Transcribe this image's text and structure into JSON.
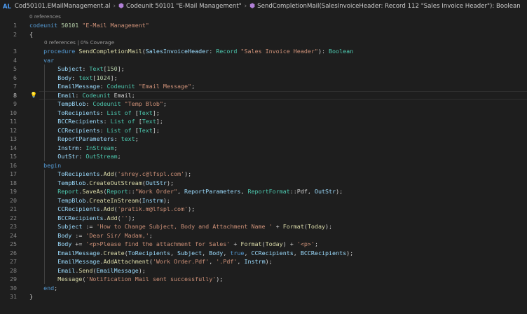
{
  "breadcrumb": {
    "lang_badge": "AL",
    "file": "Cod50101.EMailManagement.al",
    "codeunit": "Codeunit 50101 \"E-Mail Management\"",
    "procedure": "SendCompletionMail(SalesInvoiceHeader: Record 112 \"Sales Invoice Header\"): Boolean"
  },
  "hints": {
    "top_references": "0 references",
    "proc_references": "0 references | 0% Coverage"
  },
  "line_numbers": [
    "1",
    "2",
    "3",
    "4",
    "5",
    "6",
    "7",
    "8",
    "9",
    "10",
    "11",
    "12",
    "13",
    "14",
    "15",
    "16",
    "17",
    "18",
    "19",
    "20",
    "21",
    "22",
    "23",
    "24",
    "25",
    "26",
    "27",
    "28",
    "29",
    "30",
    "31"
  ],
  "code": [
    [
      [
        "k",
        "codeunit "
      ],
      [
        "n",
        "50101 "
      ],
      [
        "s",
        "\"E-Mail Management\""
      ]
    ],
    [
      [
        "p",
        "{"
      ]
    ],
    [
      [
        "p",
        "    "
      ],
      [
        "k",
        "procedure "
      ],
      [
        "f",
        "SendCompletionMail"
      ],
      [
        "p",
        "("
      ],
      [
        "v",
        "SalesInvoiceHeader"
      ],
      [
        "p",
        ": "
      ],
      [
        "t",
        "Record "
      ],
      [
        "s",
        "\"Sales Invoice Header\""
      ],
      [
        "p",
        "): "
      ],
      [
        "t",
        "Boolean"
      ]
    ],
    [
      [
        "p",
        "    "
      ],
      [
        "k",
        "var"
      ]
    ],
    [
      [
        "p",
        "        "
      ],
      [
        "v",
        "Subject"
      ],
      [
        "p",
        ": "
      ],
      [
        "t",
        "Text"
      ],
      [
        "p",
        "["
      ],
      [
        "n",
        "150"
      ],
      [
        "p",
        "];"
      ]
    ],
    [
      [
        "p",
        "        "
      ],
      [
        "v",
        "Body"
      ],
      [
        "p",
        ": "
      ],
      [
        "t",
        "text"
      ],
      [
        "p",
        "["
      ],
      [
        "n",
        "1024"
      ],
      [
        "p",
        "];"
      ]
    ],
    [
      [
        "p",
        "        "
      ],
      [
        "v",
        "EmailMessage"
      ],
      [
        "p",
        ": "
      ],
      [
        "t",
        "Codeunit "
      ],
      [
        "s",
        "\"Email Message\""
      ],
      [
        "p",
        ";"
      ]
    ],
    [
      [
        "p",
        "        "
      ],
      [
        "v",
        "Email"
      ],
      [
        "p",
        ": "
      ],
      [
        "t",
        "Codeunit "
      ],
      [
        "p",
        "Email;"
      ]
    ],
    [
      [
        "p",
        "        "
      ],
      [
        "v",
        "TempBlob"
      ],
      [
        "p",
        ": "
      ],
      [
        "t",
        "Codeunit "
      ],
      [
        "s",
        "\"Temp Blob\""
      ],
      [
        "p",
        ";"
      ]
    ],
    [
      [
        "p",
        "        "
      ],
      [
        "v",
        "ToRecipients"
      ],
      [
        "p",
        ": "
      ],
      [
        "t",
        "List of "
      ],
      [
        "p",
        "["
      ],
      [
        "t",
        "Text"
      ],
      [
        "p",
        "];"
      ]
    ],
    [
      [
        "p",
        "        "
      ],
      [
        "v",
        "BCCRecipients"
      ],
      [
        "p",
        ": "
      ],
      [
        "t",
        "List of "
      ],
      [
        "p",
        "["
      ],
      [
        "t",
        "Text"
      ],
      [
        "p",
        "];"
      ]
    ],
    [
      [
        "p",
        "        "
      ],
      [
        "v",
        "CCRecipients"
      ],
      [
        "p",
        ": "
      ],
      [
        "t",
        "List of "
      ],
      [
        "p",
        "["
      ],
      [
        "t",
        "Text"
      ],
      [
        "p",
        "];"
      ]
    ],
    [
      [
        "p",
        "        "
      ],
      [
        "v",
        "ReportParameters"
      ],
      [
        "p",
        ": "
      ],
      [
        "t",
        "text"
      ],
      [
        "p",
        ";"
      ]
    ],
    [
      [
        "p",
        "        "
      ],
      [
        "v",
        "Instrm"
      ],
      [
        "p",
        ": "
      ],
      [
        "t",
        "InStream"
      ],
      [
        "p",
        ";"
      ]
    ],
    [
      [
        "p",
        "        "
      ],
      [
        "v",
        "OutStr"
      ],
      [
        "p",
        ": "
      ],
      [
        "t",
        "OutStream"
      ],
      [
        "p",
        ";"
      ]
    ],
    [
      [
        "p",
        "    "
      ],
      [
        "k",
        "begin"
      ]
    ],
    [
      [
        "p",
        "        "
      ],
      [
        "v",
        "ToRecipients"
      ],
      [
        "p",
        "."
      ],
      [
        "f",
        "Add"
      ],
      [
        "p",
        "("
      ],
      [
        "s",
        "'shrey.c@lfspl.com'"
      ],
      [
        "p",
        ");"
      ]
    ],
    [
      [
        "p",
        "        "
      ],
      [
        "v",
        "TempBlob"
      ],
      [
        "p",
        "."
      ],
      [
        "f",
        "CreateOutStream"
      ],
      [
        "p",
        "("
      ],
      [
        "v",
        "OutStr"
      ],
      [
        "p",
        ");"
      ]
    ],
    [
      [
        "p",
        "        "
      ],
      [
        "t",
        "Report"
      ],
      [
        "p",
        "."
      ],
      [
        "f",
        "SaveAs"
      ],
      [
        "p",
        "("
      ],
      [
        "t",
        "Report"
      ],
      [
        "p",
        "::"
      ],
      [
        "s",
        "\"Work Order\""
      ],
      [
        "p",
        ", "
      ],
      [
        "v",
        "ReportParameters"
      ],
      [
        "p",
        ", "
      ],
      [
        "t",
        "ReportFormat"
      ],
      [
        "p",
        "::Pdf, "
      ],
      [
        "v",
        "OutStr"
      ],
      [
        "p",
        ");"
      ]
    ],
    [
      [
        "p",
        "        "
      ],
      [
        "v",
        "TempBlob"
      ],
      [
        "p",
        "."
      ],
      [
        "f",
        "CreateInStream"
      ],
      [
        "p",
        "("
      ],
      [
        "v",
        "Instrm"
      ],
      [
        "p",
        ");"
      ]
    ],
    [
      [
        "p",
        "        "
      ],
      [
        "v",
        "CCRecipients"
      ],
      [
        "p",
        "."
      ],
      [
        "f",
        "Add"
      ],
      [
        "p",
        "("
      ],
      [
        "s",
        "'pratik.m@lfspl.com'"
      ],
      [
        "p",
        ");"
      ]
    ],
    [
      [
        "p",
        "        "
      ],
      [
        "v",
        "BCCRecipients"
      ],
      [
        "p",
        "."
      ],
      [
        "f",
        "Add"
      ],
      [
        "p",
        "("
      ],
      [
        "s",
        "''"
      ],
      [
        "p",
        ");"
      ]
    ],
    [
      [
        "p",
        "        "
      ],
      [
        "v",
        "Subject"
      ],
      [
        "p",
        " := "
      ],
      [
        "s",
        "'How to Change Subject, Body and Attachment Name '"
      ],
      [
        "p",
        " + "
      ],
      [
        "f",
        "Format"
      ],
      [
        "p",
        "("
      ],
      [
        "f",
        "Today"
      ],
      [
        "p",
        ");"
      ]
    ],
    [
      [
        "p",
        "        "
      ],
      [
        "v",
        "Body"
      ],
      [
        "p",
        " := "
      ],
      [
        "s",
        "'Dear Sir/ Madam,'"
      ],
      [
        "p",
        ";"
      ]
    ],
    [
      [
        "p",
        "        "
      ],
      [
        "v",
        "Body"
      ],
      [
        "p",
        " += "
      ],
      [
        "s",
        "'<p>Please find the attachment for Sales'"
      ],
      [
        "p",
        " + "
      ],
      [
        "f",
        "Format"
      ],
      [
        "p",
        "("
      ],
      [
        "f",
        "Today"
      ],
      [
        "p",
        ") + "
      ],
      [
        "s",
        "'<p>'"
      ],
      [
        "p",
        ";"
      ]
    ],
    [
      [
        "p",
        "        "
      ],
      [
        "v",
        "EmailMessage"
      ],
      [
        "p",
        "."
      ],
      [
        "f",
        "Create"
      ],
      [
        "p",
        "("
      ],
      [
        "v",
        "ToRecipients"
      ],
      [
        "p",
        ", "
      ],
      [
        "v",
        "Subject"
      ],
      [
        "p",
        ", "
      ],
      [
        "v",
        "Body"
      ],
      [
        "p",
        ", "
      ],
      [
        "k",
        "true"
      ],
      [
        "p",
        ", "
      ],
      [
        "v",
        "CCRecipients"
      ],
      [
        "p",
        ", "
      ],
      [
        "v",
        "BCCRecipients"
      ],
      [
        "p",
        ");"
      ]
    ],
    [
      [
        "p",
        "        "
      ],
      [
        "v",
        "EmailMessage"
      ],
      [
        "p",
        "."
      ],
      [
        "f",
        "AddAttachment"
      ],
      [
        "p",
        "("
      ],
      [
        "s",
        "'Work Order.Pdf'"
      ],
      [
        "p",
        ", "
      ],
      [
        "s",
        "'.Pdf'"
      ],
      [
        "p",
        ", "
      ],
      [
        "v",
        "Instrm"
      ],
      [
        "p",
        ");"
      ]
    ],
    [
      [
        "p",
        "        "
      ],
      [
        "v",
        "Email"
      ],
      [
        "p",
        "."
      ],
      [
        "f",
        "Send"
      ],
      [
        "p",
        "("
      ],
      [
        "v",
        "EmailMessage"
      ],
      [
        "p",
        ");"
      ]
    ],
    [
      [
        "p",
        "        "
      ],
      [
        "f",
        "Message"
      ],
      [
        "p",
        "("
      ],
      [
        "s",
        "'Notification Mail sent successfully'"
      ],
      [
        "p",
        ");"
      ]
    ],
    [
      [
        "p",
        "    "
      ],
      [
        "k",
        "end"
      ],
      [
        "p",
        ";"
      ]
    ],
    [
      [
        "p",
        "}"
      ]
    ]
  ],
  "active_line": 8,
  "lightbulb_line": 8,
  "colors": {
    "background": "#1e1e1e",
    "keyword": "#569cd6",
    "type": "#4ec9b0",
    "string": "#ce9178",
    "function": "#dcdcaa",
    "variable": "#9cdcfe",
    "number": "#b5cea8",
    "lightbulb": "#ffcc00"
  },
  "icons": {
    "breadcrumb_separator": "chevron-right-icon",
    "codeunit": "cube-icon",
    "procedure": "cube-icon",
    "quick_fix": "lightbulb-icon"
  }
}
